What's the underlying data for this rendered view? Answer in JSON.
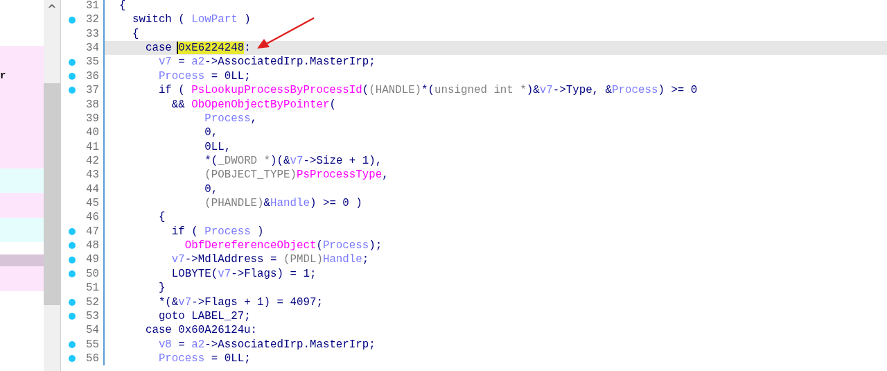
{
  "left_pane": {
    "rows": [
      {
        "color": "#fde6fb"
      },
      {
        "color": "#fde6fb"
      },
      {
        "color": "#fde6fb",
        "text": "r"
      },
      {
        "color": "#fde6fb"
      },
      {
        "color": "#fde6fb"
      },
      {
        "color": "#fde6fb"
      },
      {
        "color": "#fde6fb"
      },
      {
        "color": "#fde6fb"
      },
      {
        "color": "#fde6fb"
      },
      {
        "color": "#fde6fb"
      },
      {
        "color": "#e6fdfd"
      },
      {
        "color": "#e6fdfd"
      },
      {
        "color": "#fde6fb"
      },
      {
        "color": "#fde6fb"
      },
      {
        "color": "#e6fdfd"
      },
      {
        "color": "#e6fdfd"
      },
      {
        "color": "#ffffff"
      },
      {
        "color": "#d8c4d8"
      },
      {
        "color": "#fde6fb"
      },
      {
        "color": "#fde6fb"
      }
    ]
  },
  "scrollbar": {
    "up_arrow": "^"
  },
  "code": {
    "lines": [
      {
        "number": "31",
        "marked": false,
        "current": false,
        "tokens": [
          {
            "text": "{",
            "kind": "plain"
          }
        ]
      },
      {
        "number": "32",
        "marked": true,
        "current": false,
        "tokens": [
          {
            "text": "  switch ( ",
            "kind": "plain"
          },
          {
            "text": "LowPart",
            "kind": "var"
          },
          {
            "text": " )",
            "kind": "plain"
          }
        ]
      },
      {
        "number": "33",
        "marked": false,
        "current": false,
        "tokens": [
          {
            "text": "  {",
            "kind": "plain"
          }
        ]
      },
      {
        "number": "34",
        "marked": false,
        "current": true,
        "tokens": [
          {
            "text": "    case ",
            "kind": "plain"
          },
          {
            "text": "0xE6224248",
            "kind": "plain",
            "highlighted": true
          },
          {
            "text": ":",
            "kind": "plain"
          }
        ]
      },
      {
        "number": "35",
        "marked": true,
        "current": false,
        "tokens": [
          {
            "text": "      v7",
            "kind": "var"
          },
          {
            "text": " = ",
            "kind": "plain"
          },
          {
            "text": "a2",
            "kind": "var"
          },
          {
            "text": "->AssociatedIrp.MasterIrp;",
            "kind": "plain"
          }
        ]
      },
      {
        "number": "36",
        "marked": true,
        "current": false,
        "tokens": [
          {
            "text": "      Process",
            "kind": "var"
          },
          {
            "text": " = 0LL;",
            "kind": "plain"
          }
        ]
      },
      {
        "number": "37",
        "marked": true,
        "current": false,
        "tokens": [
          {
            "text": "      if ( ",
            "kind": "plain"
          },
          {
            "text": "PsLookupProcessByProcessId",
            "kind": "func"
          },
          {
            "text": "(",
            "kind": "plain"
          },
          {
            "text": "(HANDLE)",
            "kind": "type"
          },
          {
            "text": "*(",
            "kind": "plain"
          },
          {
            "text": "unsigned int *",
            "kind": "type"
          },
          {
            "text": ")&",
            "kind": "plain"
          },
          {
            "text": "v7",
            "kind": "var"
          },
          {
            "text": "->Type, &",
            "kind": "plain"
          },
          {
            "text": "Process",
            "kind": "var"
          },
          {
            "text": ") >= 0",
            "kind": "plain"
          }
        ]
      },
      {
        "number": "38",
        "marked": false,
        "current": false,
        "tokens": [
          {
            "text": "        && ",
            "kind": "plain"
          },
          {
            "text": "ObOpenObjectByPointer",
            "kind": "func"
          },
          {
            "text": "(",
            "kind": "plain"
          }
        ]
      },
      {
        "number": "39",
        "marked": false,
        "current": false,
        "tokens": [
          {
            "text": "             Process",
            "kind": "var"
          },
          {
            "text": ",",
            "kind": "plain"
          }
        ]
      },
      {
        "number": "40",
        "marked": false,
        "current": false,
        "tokens": [
          {
            "text": "             0,",
            "kind": "plain"
          }
        ]
      },
      {
        "number": "41",
        "marked": false,
        "current": false,
        "tokens": [
          {
            "text": "             0LL,",
            "kind": "plain"
          }
        ]
      },
      {
        "number": "42",
        "marked": false,
        "current": false,
        "tokens": [
          {
            "text": "             *(",
            "kind": "plain"
          },
          {
            "text": "_DWORD *",
            "kind": "type"
          },
          {
            "text": ")(&",
            "kind": "plain"
          },
          {
            "text": "v7",
            "kind": "var"
          },
          {
            "text": "->Size + 1),",
            "kind": "plain"
          }
        ]
      },
      {
        "number": "43",
        "marked": false,
        "current": false,
        "tokens": [
          {
            "text": "             (POBJECT_TYPE)",
            "kind": "type"
          },
          {
            "text": "PsProcessType",
            "kind": "func"
          },
          {
            "text": ",",
            "kind": "plain"
          }
        ]
      },
      {
        "number": "44",
        "marked": false,
        "current": false,
        "tokens": [
          {
            "text": "             0,",
            "kind": "plain"
          }
        ]
      },
      {
        "number": "45",
        "marked": false,
        "current": false,
        "tokens": [
          {
            "text": "             (PHANDLE)",
            "kind": "type"
          },
          {
            "text": "&",
            "kind": "plain"
          },
          {
            "text": "Handle",
            "kind": "var"
          },
          {
            "text": ") >= 0 )",
            "kind": "plain"
          }
        ]
      },
      {
        "number": "46",
        "marked": false,
        "current": false,
        "tokens": [
          {
            "text": "      {",
            "kind": "plain"
          }
        ]
      },
      {
        "number": "47",
        "marked": true,
        "current": false,
        "tokens": [
          {
            "text": "        if ( ",
            "kind": "plain"
          },
          {
            "text": "Process",
            "kind": "var"
          },
          {
            "text": " )",
            "kind": "plain"
          }
        ]
      },
      {
        "number": "48",
        "marked": true,
        "current": false,
        "tokens": [
          {
            "text": "          ObfDereferenceObject",
            "kind": "func"
          },
          {
            "text": "(",
            "kind": "plain"
          },
          {
            "text": "Process",
            "kind": "var"
          },
          {
            "text": ");",
            "kind": "plain"
          }
        ]
      },
      {
        "number": "49",
        "marked": true,
        "current": false,
        "tokens": [
          {
            "text": "        v7",
            "kind": "var"
          },
          {
            "text": "->MdlAddress = ",
            "kind": "plain"
          },
          {
            "text": "(PMDL)",
            "kind": "type"
          },
          {
            "text": "Handle",
            "kind": "var"
          },
          {
            "text": ";",
            "kind": "plain"
          }
        ]
      },
      {
        "number": "50",
        "marked": true,
        "current": false,
        "tokens": [
          {
            "text": "        LOBYTE(",
            "kind": "plain"
          },
          {
            "text": "v7",
            "kind": "var"
          },
          {
            "text": "->Flags) = 1;",
            "kind": "plain"
          }
        ]
      },
      {
        "number": "51",
        "marked": false,
        "current": false,
        "tokens": [
          {
            "text": "      }",
            "kind": "plain"
          }
        ]
      },
      {
        "number": "52",
        "marked": true,
        "current": false,
        "tokens": [
          {
            "text": "      *(&",
            "kind": "plain"
          },
          {
            "text": "v7",
            "kind": "var"
          },
          {
            "text": "->Flags + 1) = 4097;",
            "kind": "plain"
          }
        ]
      },
      {
        "number": "53",
        "marked": true,
        "current": false,
        "tokens": [
          {
            "text": "      goto LABEL_27;",
            "kind": "plain"
          }
        ]
      },
      {
        "number": "54",
        "marked": false,
        "current": false,
        "tokens": [
          {
            "text": "    case 0x60A26124u:",
            "kind": "plain"
          }
        ]
      },
      {
        "number": "55",
        "marked": true,
        "current": false,
        "tokens": [
          {
            "text": "      v8",
            "kind": "var"
          },
          {
            "text": " = ",
            "kind": "plain"
          },
          {
            "text": "a2",
            "kind": "var"
          },
          {
            "text": "->AssociatedIrp.MasterIrp;",
            "kind": "plain"
          }
        ]
      },
      {
        "number": "56",
        "marked": true,
        "current": false,
        "tokens": [
          {
            "text": "      Process",
            "kind": "var"
          },
          {
            "text": " = 0LL;",
            "kind": "plain"
          }
        ]
      }
    ]
  }
}
